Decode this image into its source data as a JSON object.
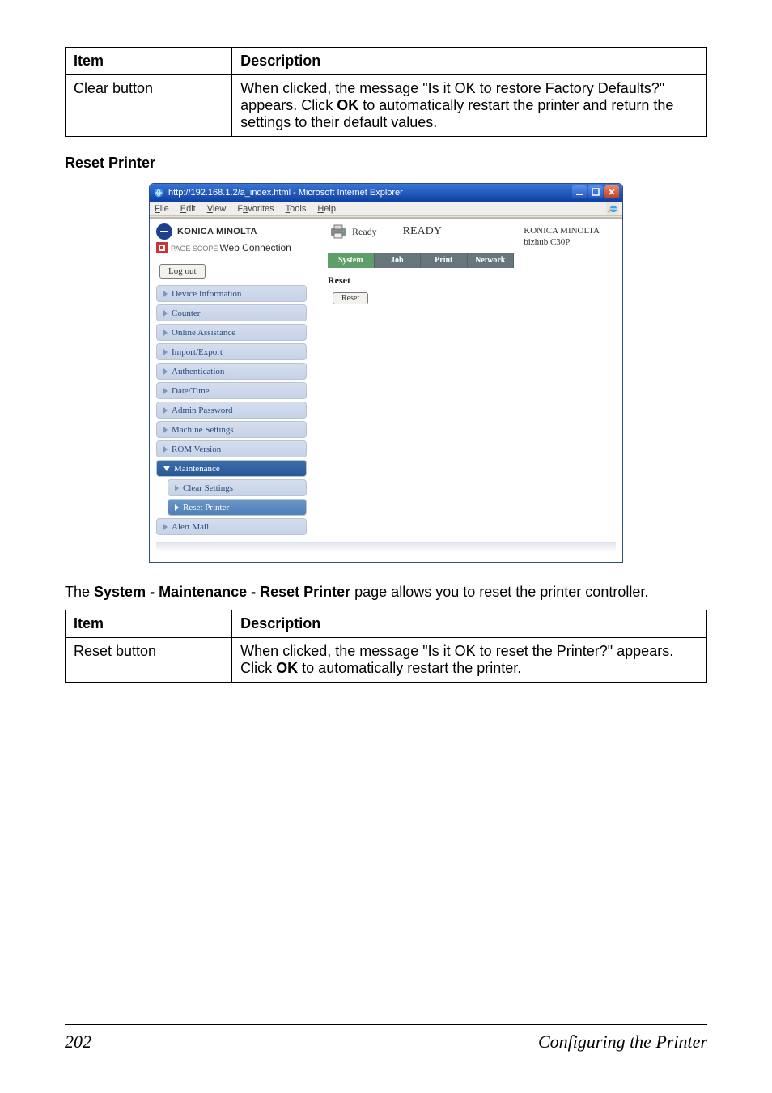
{
  "tables": {
    "t1": {
      "head_item": "Item",
      "head_desc": "Description",
      "row_item": "Clear button",
      "row_desc": "When clicked, the message \"Is it OK to restore Factory Defaults?\" appears. Click OK to automatically restart the printer and return the settings to their default values."
    },
    "t2": {
      "head_item": "Item",
      "head_desc": "Description",
      "row_item": "Reset button",
      "row_desc": "When clicked, the message \"Is it OK to reset the Printer?\" appears. Click OK to automatically restart the printer."
    }
  },
  "section_heading": "Reset Printer",
  "intro": "The System - Maintenance - Reset Printer page allows you to reset the printer controller.",
  "footer": {
    "page": "202",
    "title": "Configuring the Printer"
  },
  "shot": {
    "title": "http://192.168.1.2/a_index.html - Microsoft Internet Explorer",
    "menu": [
      "File",
      "Edit",
      "View",
      "Favorites",
      "Tools",
      "Help"
    ],
    "brand": {
      "logo": "KONICA MINOLTA",
      "product_small": "PAGE SCOPE",
      "product": "Web Connection"
    },
    "status_label": "Ready",
    "status_big": "READY",
    "model": {
      "line1": "KONICA MINOLTA",
      "line2": "bizhub C30P"
    },
    "logout": "Log out",
    "tabs": [
      "System",
      "Job",
      "Print",
      "Network"
    ],
    "sidebar": [
      "Device Information",
      "Counter",
      "Online Assistance",
      "Import/Export",
      "Authentication",
      "Date/Time",
      "Admin Password",
      "Machine Settings",
      "ROM Version",
      "Maintenance",
      "Clear Settings",
      "Reset Printer",
      "Alert Mail"
    ],
    "panel": {
      "title": "Reset",
      "button": "Reset"
    }
  }
}
